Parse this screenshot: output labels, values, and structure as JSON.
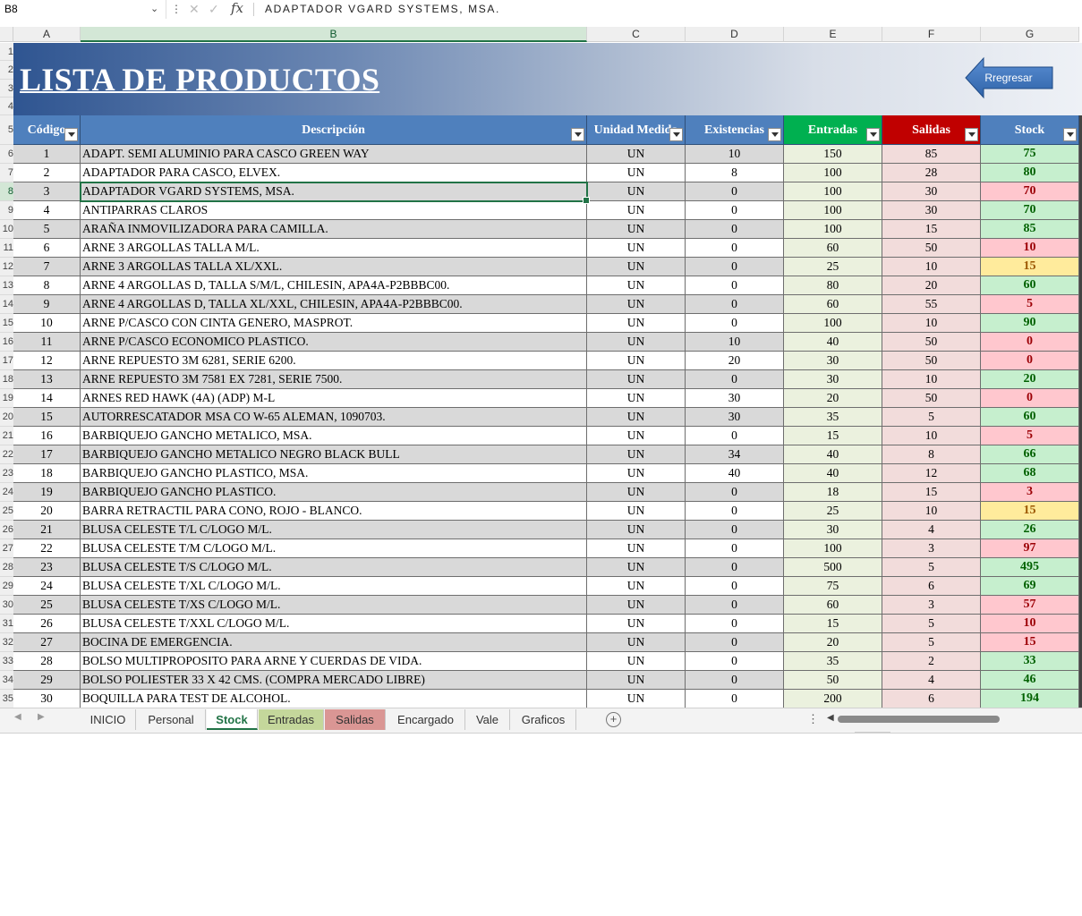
{
  "formula_bar": {
    "name_box": "B8",
    "fx_label": "fx",
    "content": "ADAPTADOR VGARD SYSTEMS, MSA."
  },
  "columns": [
    "A",
    "B",
    "C",
    "D",
    "E",
    "F",
    "G"
  ],
  "row_numbers": [
    "1",
    "2",
    "3",
    "4",
    "5",
    "6",
    "7",
    "8",
    "9",
    "10",
    "11",
    "12",
    "13",
    "14",
    "15",
    "16",
    "17",
    "18",
    "19",
    "20",
    "21",
    "22",
    "23",
    "24",
    "25",
    "26",
    "27",
    "28",
    "29",
    "30",
    "31",
    "32",
    "33",
    "34",
    "35"
  ],
  "banner": {
    "title": "LISTA DE PRODUCTOS",
    "back_button": "Rregresar"
  },
  "table": {
    "headers": [
      "Código",
      "Descripción",
      "Unidad Medida",
      "Existencias",
      "Entradas",
      "Salidas",
      "Stock"
    ],
    "rows": [
      {
        "code": "1",
        "desc": "ADAPT. SEMI  ALUMINIO PARA CASCO GREEN WAY",
        "unit": "UN",
        "exist": "10",
        "in": "150",
        "out": "85",
        "stock": "75",
        "status": "green"
      },
      {
        "code": "2",
        "desc": "ADAPTADOR PARA CASCO, ELVEX.",
        "unit": "UN",
        "exist": "8",
        "in": "100",
        "out": "28",
        "stock": "80",
        "status": "green"
      },
      {
        "code": "3",
        "desc": "ADAPTADOR VGARD SYSTEMS, MSA.",
        "unit": "UN",
        "exist": "0",
        "in": "100",
        "out": "30",
        "stock": "70",
        "status": "red"
      },
      {
        "code": "4",
        "desc": "ANTIPARRAS CLAROS",
        "unit": "UN",
        "exist": "0",
        "in": "100",
        "out": "30",
        "stock": "70",
        "status": "green"
      },
      {
        "code": "5",
        "desc": "ARAÑA INMOVILIZADORA PARA CAMILLA.",
        "unit": "UN",
        "exist": "0",
        "in": "100",
        "out": "15",
        "stock": "85",
        "status": "green"
      },
      {
        "code": "6",
        "desc": "ARNE 3 ARGOLLAS TALLA M/L.",
        "unit": "UN",
        "exist": "0",
        "in": "60",
        "out": "50",
        "stock": "10",
        "status": "red"
      },
      {
        "code": "7",
        "desc": "ARNE 3 ARGOLLAS TALLA XL/XXL.",
        "unit": "UN",
        "exist": "0",
        "in": "25",
        "out": "10",
        "stock": "15",
        "status": "yellow"
      },
      {
        "code": "8",
        "desc": "ARNE 4 ARGOLLAS D, TALLA S/M/L, CHILESIN, APA4A-P2BBBC00.",
        "unit": "UN",
        "exist": "0",
        "in": "80",
        "out": "20",
        "stock": "60",
        "status": "green"
      },
      {
        "code": "9",
        "desc": "ARNE 4 ARGOLLAS D, TALLA XL/XXL, CHILESIN, APA4A-P2BBBC00.",
        "unit": "UN",
        "exist": "0",
        "in": "60",
        "out": "55",
        "stock": "5",
        "status": "red"
      },
      {
        "code": "10",
        "desc": "ARNE P/CASCO CON CINTA GENERO, MASPROT.",
        "unit": "UN",
        "exist": "0",
        "in": "100",
        "out": "10",
        "stock": "90",
        "status": "green"
      },
      {
        "code": "11",
        "desc": "ARNE P/CASCO ECONOMICO PLASTICO.",
        "unit": "UN",
        "exist": "10",
        "in": "40",
        "out": "50",
        "stock": "0",
        "status": "red"
      },
      {
        "code": "12",
        "desc": "ARNE REPUESTO 3M 6281, SERIE 6200.",
        "unit": "UN",
        "exist": "20",
        "in": "30",
        "out": "50",
        "stock": "0",
        "status": "red"
      },
      {
        "code": "13",
        "desc": "ARNE REPUESTO 3M 7581 EX 7281, SERIE 7500.",
        "unit": "UN",
        "exist": "0",
        "in": "30",
        "out": "10",
        "stock": "20",
        "status": "green"
      },
      {
        "code": "14",
        "desc": "ARNES RED HAWK (4A) (ADP) M-L",
        "unit": "UN",
        "exist": "30",
        "in": "20",
        "out": "50",
        "stock": "0",
        "status": "red"
      },
      {
        "code": "15",
        "desc": "AUTORRESCATADOR MSA CO W-65 ALEMAN, 1090703.",
        "unit": "UN",
        "exist": "30",
        "in": "35",
        "out": "5",
        "stock": "60",
        "status": "green"
      },
      {
        "code": "16",
        "desc": "BARBIQUEJO GANCHO METALICO, MSA.",
        "unit": "UN",
        "exist": "0",
        "in": "15",
        "out": "10",
        "stock": "5",
        "status": "red"
      },
      {
        "code": "17",
        "desc": "BARBIQUEJO GANCHO METALICO NEGRO BLACK BULL",
        "unit": "UN",
        "exist": "34",
        "in": "40",
        "out": "8",
        "stock": "66",
        "status": "green"
      },
      {
        "code": "18",
        "desc": "BARBIQUEJO GANCHO PLASTICO, MSA.",
        "unit": "UN",
        "exist": "40",
        "in": "40",
        "out": "12",
        "stock": "68",
        "status": "green"
      },
      {
        "code": "19",
        "desc": "BARBIQUEJO GANCHO PLASTICO.",
        "unit": "UN",
        "exist": "0",
        "in": "18",
        "out": "15",
        "stock": "3",
        "status": "red"
      },
      {
        "code": "20",
        "desc": "BARRA RETRACTIL PARA CONO, ROJO - BLANCO.",
        "unit": "UN",
        "exist": "0",
        "in": "25",
        "out": "10",
        "stock": "15",
        "status": "yellow"
      },
      {
        "code": "21",
        "desc": "BLUSA CELESTE T/L C/LOGO M/L.",
        "unit": "UN",
        "exist": "0",
        "in": "30",
        "out": "4",
        "stock": "26",
        "status": "green"
      },
      {
        "code": "22",
        "desc": "BLUSA CELESTE T/M C/LOGO M/L.",
        "unit": "UN",
        "exist": "0",
        "in": "100",
        "out": "3",
        "stock": "97",
        "status": "red"
      },
      {
        "code": "23",
        "desc": "BLUSA CELESTE T/S C/LOGO M/L.",
        "unit": "UN",
        "exist": "0",
        "in": "500",
        "out": "5",
        "stock": "495",
        "status": "green"
      },
      {
        "code": "24",
        "desc": "BLUSA CELESTE T/XL C/LOGO M/L.",
        "unit": "UN",
        "exist": "0",
        "in": "75",
        "out": "6",
        "stock": "69",
        "status": "green"
      },
      {
        "code": "25",
        "desc": "BLUSA CELESTE T/XS C/LOGO M/L.",
        "unit": "UN",
        "exist": "0",
        "in": "60",
        "out": "3",
        "stock": "57",
        "status": "red"
      },
      {
        "code": "26",
        "desc": "BLUSA CELESTE T/XXL C/LOGO M/L.",
        "unit": "UN",
        "exist": "0",
        "in": "15",
        "out": "5",
        "stock": "10",
        "status": "red"
      },
      {
        "code": "27",
        "desc": "BOCINA DE EMERGENCIA.",
        "unit": "UN",
        "exist": "0",
        "in": "20",
        "out": "5",
        "stock": "15",
        "status": "red"
      },
      {
        "code": "28",
        "desc": "BOLSO MULTIPROPOSITO PARA ARNE Y CUERDAS DE VIDA.",
        "unit": "UN",
        "exist": "0",
        "in": "35",
        "out": "2",
        "stock": "33",
        "status": "green"
      },
      {
        "code": "29",
        "desc": "BOLSO POLIESTER 33 X 42 CMS. (COMPRA MERCADO LIBRE)",
        "unit": "UN",
        "exist": "0",
        "in": "50",
        "out": "4",
        "stock": "46",
        "status": "green"
      },
      {
        "code": "30",
        "desc": "BOQUILLA PARA TEST DE ALCOHOL.",
        "unit": "UN",
        "exist": "0",
        "in": "200",
        "out": "6",
        "stock": "194",
        "status": "green"
      }
    ]
  },
  "sheet_tabs": [
    "INICIO",
    "Personal",
    "Stock",
    "Entradas",
    "Salidas",
    "Encargado",
    "Vale",
    "Graficos"
  ],
  "active_sheet": "Stock",
  "colors": {
    "header_blue": "#4f80bd",
    "header_green": "#00b050",
    "header_red": "#c00000",
    "stock_green": "#c6efce",
    "stock_red": "#ffc7ce",
    "stock_yellow": "#ffeb9c",
    "excel_green": "#217346"
  },
  "icons": {
    "name_box_dropdown": "chevron-down-icon",
    "cancel": "x-icon",
    "enter": "check-icon",
    "function": "fx-icon",
    "add_sheet": "plus-circle-icon"
  }
}
